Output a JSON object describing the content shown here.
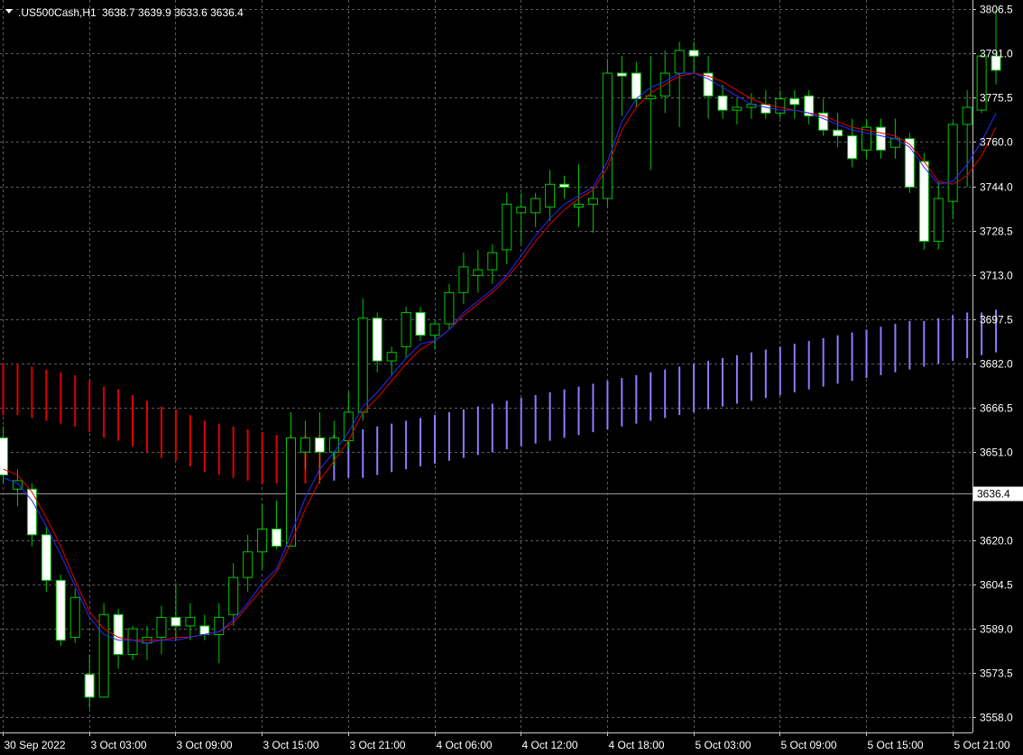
{
  "header": {
    "symbol_timeframe": ".US500Cash,H1",
    "ohlc": "3638.7 3639.9 3633.6 3636.4"
  },
  "colors": {
    "background": "#000000",
    "grid": "#5a5a5a",
    "bull_body": "#000000",
    "bear_body": "#ffffff",
    "wick": "#00c800",
    "ma_fast": "#2a2aff",
    "ma_slow": "#e00000",
    "ma_mid": "#00a000",
    "ind_down": "#e00000",
    "ind_up": "#8c7cff",
    "axis_text": "#ffffff"
  },
  "chart_data": {
    "type": "candlestick",
    "price_axis": {
      "min": 3550,
      "max": 3810,
      "ticks": [
        "3806.5",
        "3791.0",
        "3775.5",
        "3760.0",
        "3744.0",
        "3728.5",
        "3713.0",
        "3697.5",
        "3682.0",
        "3666.5",
        "3651.0",
        "3620.0",
        "3604.5",
        "3589.0",
        "3573.5",
        "3558.0"
      ],
      "current_price": "3636.4"
    },
    "time_axis": {
      "labels": [
        "30 Sep 2022",
        "3 Oct 03:00",
        "3 Oct 09:00",
        "3 Oct 15:00",
        "3 Oct 21:00",
        "4 Oct 06:00",
        "4 Oct 12:00",
        "4 Oct 18:00",
        "5 Oct 03:00",
        "5 Oct 09:00",
        "5 Oct 15:00",
        "5 Oct 21:00"
      ],
      "label_bar_index": [
        0,
        6,
        12,
        18,
        24,
        30,
        36,
        42,
        48,
        54,
        60,
        66
      ]
    },
    "candles": [
      [
        3656,
        3660,
        3640,
        3643
      ],
      [
        3638,
        3645,
        3632,
        3641
      ],
      [
        3638,
        3640,
        3618,
        3622
      ],
      [
        3622,
        3625,
        3602,
        3606
      ],
      [
        3606,
        3608,
        3583,
        3585
      ],
      [
        3586,
        3603,
        3584,
        3600
      ],
      [
        3573,
        3580,
        3561,
        3565
      ],
      [
        3565,
        3598,
        3565,
        3594
      ],
      [
        3594,
        3596,
        3575,
        3580
      ],
      [
        3580,
        3590,
        3578,
        3589
      ],
      [
        3584,
        3590,
        3578,
        3586
      ],
      [
        3586,
        3597,
        3580,
        3593
      ],
      [
        3593,
        3605,
        3585,
        3590
      ],
      [
        3590,
        3598,
        3585,
        3593
      ],
      [
        3590,
        3594,
        3585,
        3587
      ],
      [
        3587,
        3598,
        3577,
        3593
      ],
      [
        3594,
        3612,
        3590,
        3607
      ],
      [
        3607,
        3622,
        3602,
        3616
      ],
      [
        3616,
        3633,
        3610,
        3624
      ],
      [
        3624,
        3634,
        3617,
        3618
      ],
      [
        3618,
        3665,
        3618,
        3656
      ],
      [
        3651,
        3662,
        3645,
        3656
      ],
      [
        3656,
        3665,
        3640,
        3651
      ],
      [
        3651,
        3662,
        3646,
        3656
      ],
      [
        3655,
        3672,
        3652,
        3665
      ],
      [
        3665,
        3705,
        3662,
        3698
      ],
      [
        3698,
        3700,
        3679,
        3683
      ],
      [
        3683,
        3688,
        3678,
        3686
      ],
      [
        3688,
        3702,
        3684,
        3700
      ],
      [
        3700,
        3702,
        3690,
        3692
      ],
      [
        3692,
        3697,
        3687,
        3696
      ],
      [
        3696,
        3710,
        3694,
        3707
      ],
      [
        3707,
        3721,
        3703,
        3716
      ],
      [
        3713,
        3722,
        3707,
        3715
      ],
      [
        3715,
        3724,
        3710,
        3721
      ],
      [
        3722,
        3742,
        3717,
        3738
      ],
      [
        3735,
        3742,
        3724,
        3737
      ],
      [
        3735,
        3742,
        3730,
        3740
      ],
      [
        3737,
        3750,
        3732,
        3745
      ],
      [
        3745,
        3748,
        3740,
        3744
      ],
      [
        3737,
        3752,
        3730,
        3738
      ],
      [
        3738,
        3744,
        3728,
        3740
      ],
      [
        3740,
        3789,
        3737,
        3784
      ],
      [
        3784,
        3790,
        3769,
        3783
      ],
      [
        3784,
        3788,
        3772,
        3775
      ],
      [
        3775,
        3790,
        3750,
        3776
      ],
      [
        3776,
        3792,
        3770,
        3784
      ],
      [
        3784,
        3795,
        3765,
        3792
      ],
      [
        3792,
        3795,
        3784,
        3790
      ],
      [
        3784,
        3790,
        3768,
        3776
      ],
      [
        3776,
        3780,
        3768,
        3771
      ],
      [
        3771,
        3775,
        3766,
        3772
      ],
      [
        3772,
        3777,
        3768,
        3773
      ],
      [
        3773,
        3778,
        3768,
        3770
      ],
      [
        3770,
        3778,
        3768,
        3775
      ],
      [
        3775,
        3778,
        3768,
        3773
      ],
      [
        3776,
        3778,
        3766,
        3769
      ],
      [
        3770,
        3775,
        3762,
        3764
      ],
      [
        3764,
        3770,
        3758,
        3762
      ],
      [
        3762,
        3768,
        3751,
        3754
      ],
      [
        3757,
        3768,
        3754,
        3765
      ],
      [
        3765,
        3768,
        3754,
        3757
      ],
      [
        3758,
        3768,
        3754,
        3761
      ],
      [
        3761,
        3763,
        3742,
        3744
      ],
      [
        3753,
        3756,
        3722,
        3725
      ],
      [
        3725,
        3746,
        3722,
        3740
      ],
      [
        3739,
        3767,
        3733,
        3766
      ],
      [
        3766,
        3778,
        3744,
        3772
      ],
      [
        3771,
        3791,
        3770,
        3790
      ],
      [
        3790,
        3806,
        3780,
        3785
      ]
    ],
    "ma_fast": [
      3642,
      3640,
      3634,
      3625,
      3615,
      3604,
      3593,
      3587,
      3585,
      3585,
      3584,
      3585,
      3585,
      3586,
      3587,
      3588,
      3592,
      3598,
      3605,
      3610,
      3622,
      3635,
      3645,
      3651,
      3658,
      3667,
      3672,
      3678,
      3684,
      3689,
      3690,
      3694,
      3700,
      3704,
      3708,
      3713,
      3720,
      3727,
      3733,
      3738,
      3741,
      3744,
      3753,
      3767,
      3775,
      3779,
      3781,
      3784,
      3784,
      3782,
      3779,
      3776,
      3773,
      3772,
      3771,
      3771,
      3770,
      3768,
      3766,
      3764,
      3763,
      3762,
      3761,
      3758,
      3751,
      3745,
      3746,
      3752,
      3760,
      3770
    ],
    "ma_slow": [
      3645,
      3643,
      3637,
      3628,
      3618,
      3606,
      3595,
      3589,
      3586,
      3585,
      3585,
      3585,
      3586,
      3586,
      3587,
      3588,
      3591,
      3597,
      3603,
      3609,
      3619,
      3631,
      3641,
      3648,
      3655,
      3665,
      3670,
      3676,
      3682,
      3687,
      3690,
      3694,
      3699,
      3703,
      3707,
      3712,
      3718,
      3725,
      3731,
      3736,
      3740,
      3743,
      3751,
      3764,
      3772,
      3777,
      3780,
      3783,
      3784,
      3783,
      3781,
      3778,
      3775,
      3773,
      3772,
      3771,
      3770,
      3769,
      3767,
      3765,
      3764,
      3763,
      3762,
      3759,
      3753,
      3746,
      3745,
      3748,
      3755,
      3765
    ],
    "indicator": [
      [
        3682,
        3664
      ],
      [
        3682,
        3664
      ],
      [
        3681,
        3663
      ],
      [
        3680,
        3662
      ],
      [
        3679,
        3661
      ],
      [
        3678,
        3660
      ],
      [
        3676,
        3658
      ],
      [
        3674,
        3656
      ],
      [
        3673,
        3655
      ],
      [
        3671,
        3653
      ],
      [
        3669,
        3651
      ],
      [
        3667,
        3649
      ],
      [
        3666,
        3648
      ],
      [
        3664,
        3646
      ],
      [
        3662,
        3644
      ],
      [
        3661,
        3643
      ],
      [
        3660,
        3642
      ],
      [
        3659,
        3641
      ],
      [
        3658,
        3640
      ],
      [
        3657,
        3640
      ],
      [
        3657,
        3640
      ],
      [
        3657,
        3640
      ],
      [
        3657,
        3641
      ],
      [
        3657,
        3641
      ],
      [
        3659,
        3642
      ],
      [
        3659,
        3642
      ],
      [
        3660,
        3643
      ],
      [
        3661,
        3644
      ],
      [
        3662,
        3645
      ],
      [
        3663,
        3646
      ],
      [
        3664,
        3647
      ],
      [
        3665,
        3648
      ],
      [
        3666,
        3649
      ],
      [
        3667,
        3650
      ],
      [
        3668,
        3651
      ],
      [
        3669,
        3652
      ],
      [
        3670,
        3653
      ],
      [
        3671,
        3654
      ],
      [
        3672,
        3655
      ],
      [
        3673,
        3656
      ],
      [
        3674,
        3657
      ],
      [
        3675,
        3658
      ],
      [
        3676,
        3659
      ],
      [
        3677,
        3660
      ],
      [
        3678,
        3661
      ],
      [
        3679,
        3662
      ],
      [
        3680,
        3663
      ],
      [
        3681,
        3664
      ],
      [
        3682,
        3665
      ],
      [
        3683,
        3666
      ],
      [
        3684,
        3667
      ],
      [
        3685,
        3668
      ],
      [
        3686,
        3669
      ],
      [
        3687,
        3670
      ],
      [
        3688,
        3671
      ],
      [
        3689,
        3672
      ],
      [
        3690,
        3673
      ],
      [
        3691,
        3674
      ],
      [
        3692,
        3675
      ],
      [
        3693,
        3676
      ],
      [
        3694,
        3677
      ],
      [
        3695,
        3678
      ],
      [
        3696,
        3679
      ],
      [
        3697,
        3680
      ],
      [
        3697,
        3681
      ],
      [
        3698,
        3682
      ],
      [
        3699,
        3683
      ],
      [
        3700,
        3684
      ],
      [
        3700,
        3685
      ],
      [
        3701,
        3686
      ]
    ],
    "indicator_trend_change_index": 23
  }
}
